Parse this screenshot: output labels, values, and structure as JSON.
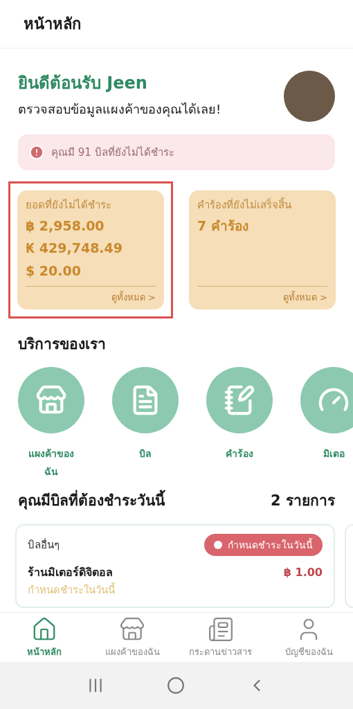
{
  "header": {
    "title": "หน้าหลัก"
  },
  "welcome": {
    "greeting": "ยินดีต้อนรับ Jeen",
    "subtitle": "ตรวจสอบข้อมูลแผงค้าของคุณได้เลย!"
  },
  "alert": {
    "text": "คุณมี 91 บิลที่ยังไม่ได้ชำระ"
  },
  "summary_cards": [
    {
      "title": "ยอดที่ยังไม่ได้ชำระ",
      "values": [
        "฿ 2,958.00",
        "₭ 429,748.49",
        "$ 20.00"
      ],
      "link": "ดูทั้งหมด >",
      "highlighted": true
    },
    {
      "title": "คำร้องที่ยังไม่เสร็จสิ้น",
      "values": [
        "7 คำร้อง"
      ],
      "link": "ดูทั้งหมด >",
      "highlighted": false
    }
  ],
  "services": {
    "title": "บริการของเรา",
    "items": [
      {
        "kind": "stall",
        "label": "แผงค้าของฉัน"
      },
      {
        "kind": "bill",
        "label": "บิล"
      },
      {
        "kind": "request",
        "label": "คำร้อง"
      },
      {
        "kind": "meter",
        "label": "มิเตอ"
      }
    ]
  },
  "bills_today": {
    "title": "คุณมีบิลที่ต้องชำระวันนี้",
    "count": "2 รายการ",
    "bills": [
      {
        "category": "บิลอื่นๆ",
        "status": "กำหนดชำระในวันนี้",
        "name": "ร้านมิเตอร์ดิจิตอล",
        "amount": "฿ 1.00",
        "due": "กำหนดชำระในวันนี้"
      }
    ]
  },
  "bottom_nav": [
    {
      "kind": "home",
      "label": "หน้าหลัก",
      "selected": true
    },
    {
      "kind": "stall",
      "label": "แผงค้าของฉัน",
      "selected": false
    },
    {
      "kind": "news",
      "label": "กระดานข่าวสาร",
      "selected": false
    },
    {
      "kind": "account",
      "label": "บัญชีของฉัน",
      "selected": false
    }
  ]
}
